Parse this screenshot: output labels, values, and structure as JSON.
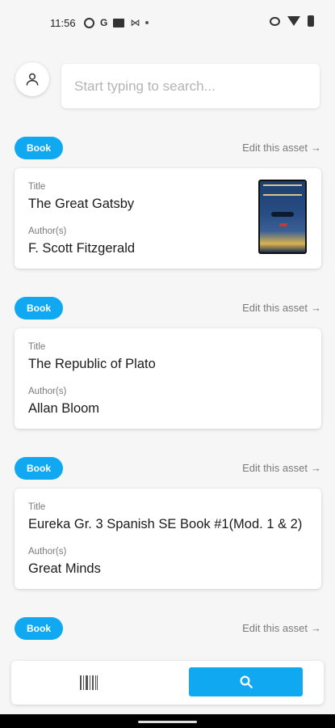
{
  "status_bar": {
    "time": "11:56",
    "left_icons": [
      "circle-status-icon",
      "google-icon",
      "message-icon",
      "gmail-icon",
      "dot-icon"
    ],
    "right_icons": [
      "eye-icon",
      "wifi-icon",
      "battery-icon"
    ]
  },
  "header": {
    "avatar_icon": "person-icon",
    "search_placeholder": "Start typing to search...",
    "search_value": ""
  },
  "assets": [
    {
      "type": "Book",
      "edit_label": "Edit this asset",
      "title_label": "Title",
      "title": "The Great Gatsby",
      "authors_label": "Author(s)",
      "authors": "F. Scott Fitzgerald",
      "has_cover": true
    },
    {
      "type": "Book",
      "edit_label": "Edit this asset",
      "title_label": "Title",
      "title": "The Republic of Plato",
      "authors_label": "Author(s)",
      "authors": "Allan Bloom",
      "has_cover": false
    },
    {
      "type": "Book",
      "edit_label": "Edit this asset",
      "title_label": "Title",
      "title": "Eureka Gr. 3 Spanish SE Book #1(Mod. 1 & 2)",
      "authors_label": "Author(s)",
      "authors": "Great Minds",
      "has_cover": false
    },
    {
      "type": "Book",
      "edit_label": "Edit this asset"
    }
  ],
  "bottom_nav": {
    "scan_icon": "barcode-icon",
    "search_icon": "search-icon",
    "active": "search"
  },
  "colors": {
    "accent": "#11a8f2",
    "background": "#f6f6f6",
    "card": "#ffffff"
  }
}
